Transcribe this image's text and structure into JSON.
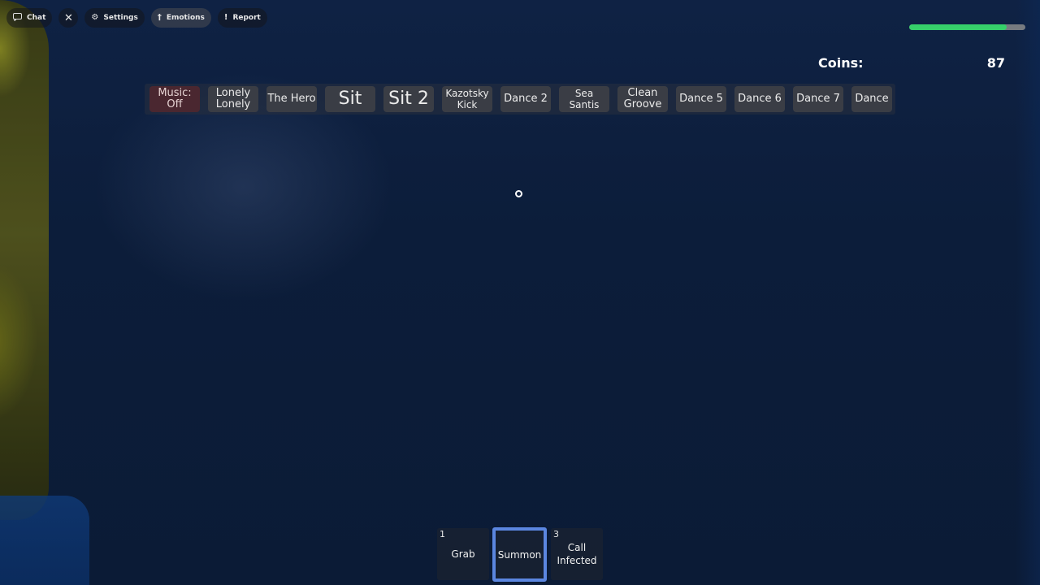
{
  "topbar": {
    "chat": "Chat",
    "close": "✕",
    "settings": "Settings",
    "emotions": "Emotions",
    "report": "Report"
  },
  "health": {
    "fraction": 0.84,
    "color": "#36d06a"
  },
  "coins": {
    "label": "Coins:",
    "value": "87"
  },
  "emotes": [
    {
      "label": "Music:\nOff"
    },
    {
      "label": "Lonely\nLonely"
    },
    {
      "label": "The Hero"
    },
    {
      "label": "Sit"
    },
    {
      "label": "Sit 2"
    },
    {
      "label": "Kazotsky\nKick"
    },
    {
      "label": "Dance 2"
    },
    {
      "label": "Sea\nSantis"
    },
    {
      "label": "Clean\nGroove"
    },
    {
      "label": "Dance 5"
    },
    {
      "label": "Dance 6"
    },
    {
      "label": "Dance 7"
    },
    {
      "label": "Dance"
    }
  ],
  "hotbar": [
    {
      "num": "1",
      "label": "Grab"
    },
    {
      "num": "",
      "label": "Summon"
    },
    {
      "num": "3",
      "label": "Call\nInfected"
    }
  ],
  "colors": {
    "accent": "#5b86e0",
    "music_off": "#4a2730"
  }
}
